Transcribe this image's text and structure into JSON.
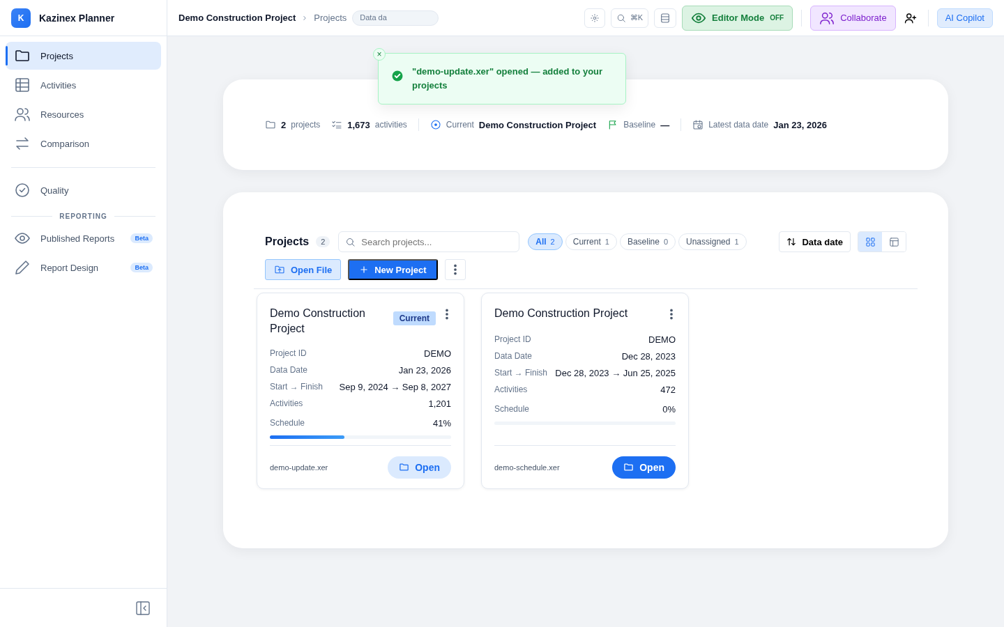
{
  "app": {
    "logo": "K",
    "name": "Kazinex Planner"
  },
  "sidebar": {
    "items": [
      {
        "label": "Projects",
        "selected": true
      },
      {
        "label": "Activities",
        "selected": false
      },
      {
        "label": "Resources",
        "selected": false
      },
      {
        "label": "Comparison",
        "selected": false
      }
    ],
    "quality": {
      "label": "Quality",
      "selected": false
    },
    "section": "REPORTING",
    "reporting": [
      {
        "label": "Published Reports",
        "badge": "Beta",
        "selected": false
      },
      {
        "label": "Report Design",
        "badge": "Beta",
        "selected": false
      }
    ]
  },
  "header": {
    "breadcrumb": [
      "Demo Construction Project",
      "Projects"
    ],
    "chip": "Data da",
    "search_shortcut": "⌘K",
    "editor": {
      "label": "Editor Mode",
      "state": "OFF",
      "on": false
    },
    "collaborate": "Collaborate",
    "copilot": "AI Copilot"
  },
  "toast": {
    "message": "\"demo-update.xer\" opened — added to your projects",
    "close": "×"
  },
  "summary": {
    "projects_count": "2",
    "projects_label": "projects",
    "activities_count": "1,673",
    "activities_label": "activities",
    "current_label": "Current",
    "current_value": "Demo Construction Project",
    "baseline_label": "Baseline",
    "baseline_value": "—",
    "date_label": "Latest data date",
    "date_value": "Jan 23, 2026"
  },
  "projects": {
    "title": "Projects",
    "count": "2",
    "search": {
      "placeholder": "Search projects..."
    },
    "filters": [
      {
        "label": "All",
        "count": "2",
        "selected": true
      },
      {
        "label": "Current",
        "count": "1",
        "selected": false
      },
      {
        "label": "Baseline",
        "count": "0",
        "selected": false
      },
      {
        "label": "Unassigned",
        "count": "1",
        "selected": false
      }
    ],
    "sort": "Data date",
    "view": [
      {
        "kind": "grid",
        "selected": true
      },
      {
        "kind": "table",
        "selected": false
      }
    ],
    "open_file": "Open File",
    "new_project": "New Project",
    "cards": [
      {
        "title": "Demo Construction Project",
        "tag": "Current",
        "rows": [
          {
            "label": "Project ID",
            "value": "DEMO"
          },
          {
            "label": "Data Date",
            "value": "Jan 23, 2026"
          },
          {
            "label": "Start → Finish",
            "value": "Sep 9, 2024 → Sep 8, 2027"
          },
          {
            "label": "Activities",
            "value": "1,201"
          }
        ],
        "schedule_label": "Schedule",
        "schedule_value": "41%",
        "level": 0.41,
        "file": "demo-update.xer",
        "open": "Open",
        "primary": false
      },
      {
        "title": "Demo Construction Project",
        "rows": [
          {
            "label": "Project ID",
            "value": "DEMO"
          },
          {
            "label": "Data Date",
            "value": "Dec 28, 2023"
          },
          {
            "label": "Start → Finish",
            "value": "Dec 28, 2023 → Jun 25, 2025"
          },
          {
            "label": "Activities",
            "value": "472"
          }
        ],
        "schedule_label": "Schedule",
        "schedule_value": "0%",
        "level": 0,
        "file": "demo-schedule.xer",
        "open": "Open",
        "primary": true
      }
    ]
  }
}
